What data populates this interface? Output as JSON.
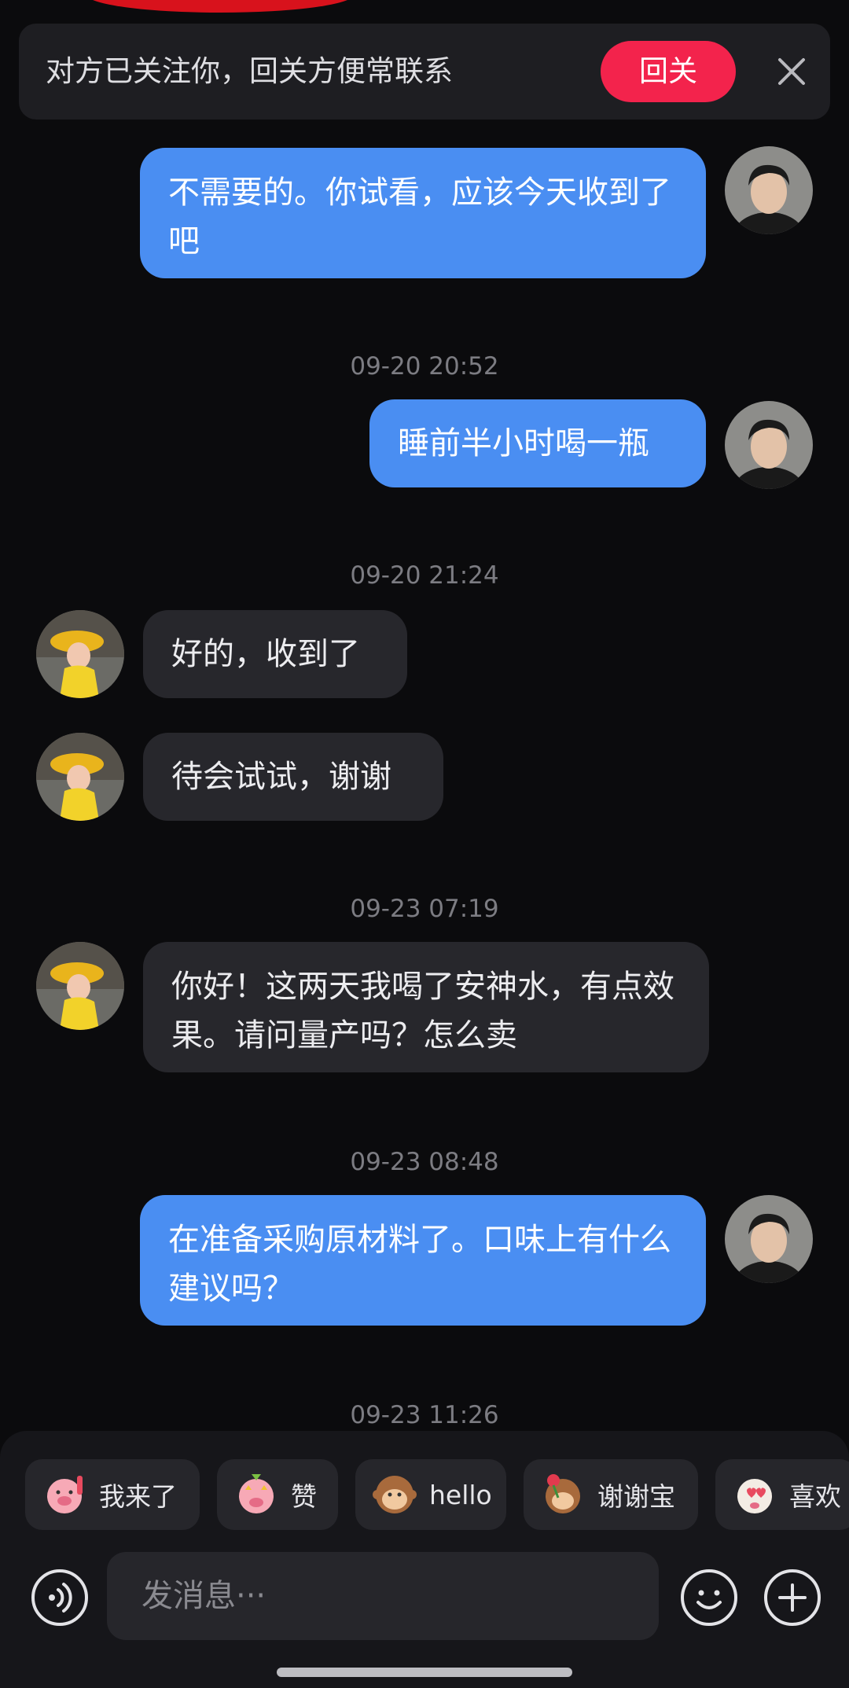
{
  "banner": {
    "text": "对方已关注你，回关方便常联系",
    "follow_label": "回关",
    "close_icon": "close-icon"
  },
  "messages": [
    {
      "sender": "me",
      "text": "不需要的。你试看，应该今天收到了吧"
    },
    {
      "timestamp": "09-20 20:52"
    },
    {
      "sender": "me",
      "text": "睡前半小时喝一瓶"
    },
    {
      "timestamp": "09-20 21:24"
    },
    {
      "sender": "them",
      "text": "好的，收到了"
    },
    {
      "sender": "them",
      "text": "待会试试，谢谢"
    },
    {
      "timestamp": "09-23 07:19"
    },
    {
      "sender": "them",
      "text": "你好！这两天我喝了安神水，有点效果。请问量产吗？怎么卖"
    },
    {
      "timestamp": "09-23 08:48"
    },
    {
      "sender": "me",
      "text": "在准备采购原材料了。口味上有什么建议吗？"
    },
    {
      "timestamp": "09-23 11:26"
    }
  ],
  "quick_replies": [
    {
      "label": "我来了",
      "icon": "pig-waving-emoji-icon"
    },
    {
      "label": "赞",
      "icon": "pig-thumbs-up-emoji-icon"
    },
    {
      "label": "hello",
      "icon": "monkey-hello-emoji-icon"
    },
    {
      "label": "谢谢宝",
      "icon": "monkey-rose-emoji-icon"
    },
    {
      "label": "喜欢",
      "icon": "heart-face-emoji-icon"
    }
  ],
  "input": {
    "placeholder": "发消息···",
    "value": ""
  },
  "colors": {
    "background": "#0b0b0d",
    "my_bubble": "#4a8ef2",
    "their_bubble": "#27272c",
    "follow_button": "#f3234c"
  },
  "icons": [
    "voice-icon",
    "emoji-icon",
    "plus-icon"
  ]
}
